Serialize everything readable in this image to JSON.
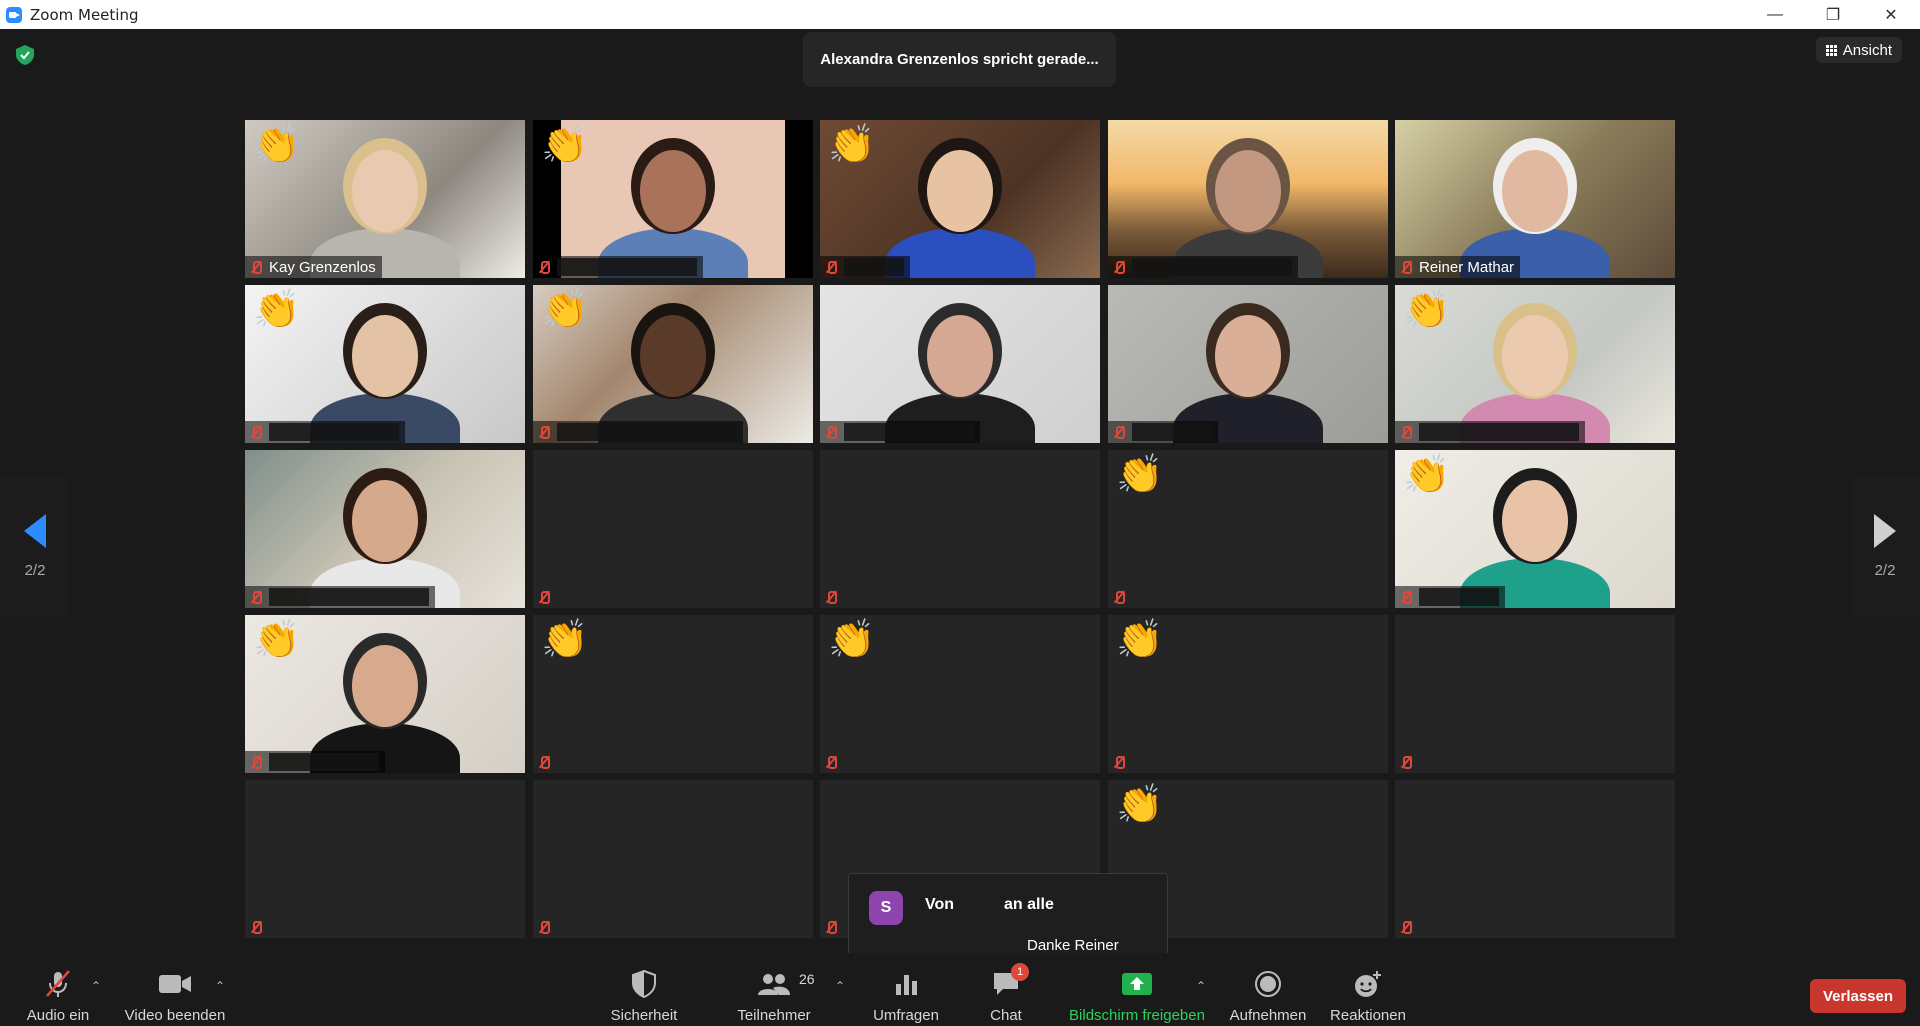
{
  "window": {
    "title": "Zoom Meeting"
  },
  "banner": {
    "speaking": "Alexandra Grenzenlos spricht gerade..."
  },
  "view": {
    "label": "Ansicht"
  },
  "pagination": {
    "left": "2/2",
    "right": "2/2"
  },
  "tiles": [
    {
      "name": "Kay Grenzenlos",
      "wave": true,
      "video": true
    },
    {
      "name": "",
      "wave": true,
      "video": true
    },
    {
      "name": "",
      "wave": true,
      "video": true
    },
    {
      "name": "",
      "wave": false,
      "video": true
    },
    {
      "name": "Reiner Mathar",
      "wave": false,
      "video": true
    },
    {
      "name": "",
      "wave": true,
      "video": true
    },
    {
      "name": "",
      "wave": true,
      "video": true
    },
    {
      "name": "",
      "wave": false,
      "video": true
    },
    {
      "name": "",
      "wave": false,
      "video": true
    },
    {
      "name": "",
      "wave": true,
      "video": true
    },
    {
      "name": "",
      "wave": false,
      "video": true
    },
    {
      "name": "",
      "wave": false,
      "video": false
    },
    {
      "name": "",
      "wave": false,
      "video": false
    },
    {
      "name": "",
      "wave": true,
      "video": false
    },
    {
      "name": "",
      "wave": true,
      "video": true
    },
    {
      "name": "",
      "wave": true,
      "video": true
    },
    {
      "name": "",
      "wave": true,
      "video": false
    },
    {
      "name": "",
      "wave": true,
      "video": false
    },
    {
      "name": "",
      "wave": true,
      "video": false
    },
    {
      "name": "",
      "wave": false,
      "video": false
    },
    {
      "name": "",
      "wave": false,
      "video": false
    },
    {
      "name": "",
      "wave": false,
      "video": false
    },
    {
      "name": "",
      "wave": false,
      "video": false
    },
    {
      "name": "",
      "wave": true,
      "video": false
    },
    {
      "name": "",
      "wave": false,
      "video": false
    }
  ],
  "chat_popup": {
    "avatar": "S",
    "from": "Von",
    "to": "an alle",
    "message": "Danke Reiner"
  },
  "toolbar": {
    "audio": "Audio ein",
    "video": "Video beenden",
    "security": "Sicherheit",
    "participants": "Teilnehmer",
    "participants_count": "26",
    "polls": "Umfragen",
    "chat": "Chat",
    "chat_badge": "1",
    "share": "Bildschirm freigeben",
    "record": "Aufnehmen",
    "reactions": "Reaktionen",
    "leave": "Verlassen"
  },
  "colors": {
    "accent": "#2d8cff",
    "share_green": "#2fd15b",
    "leave_red": "#c8362d",
    "muted_red": "#e0473b"
  }
}
